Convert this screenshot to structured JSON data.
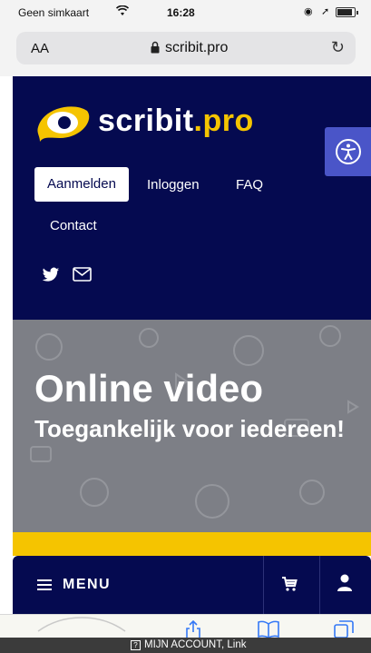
{
  "status_bar": {
    "carrier": "Geen simkaart",
    "time": "16:28",
    "icons": [
      "wifi-icon",
      "orientation-lock-icon",
      "location-icon",
      "battery-icon"
    ]
  },
  "browser": {
    "text_size_label": "AA",
    "url": "scribit.pro",
    "icons": [
      "lock-icon",
      "reload-icon"
    ]
  },
  "site": {
    "logo": {
      "name": "scribit",
      "tld": ".pro"
    },
    "nav": {
      "register": "Aanmelden",
      "login": "Inloggen",
      "faq": "FAQ",
      "contact": "Contact"
    },
    "social_icons": [
      "twitter-icon",
      "mail-icon"
    ],
    "accessibility_icon": "accessibility-icon"
  },
  "hero": {
    "title": "Online video",
    "subtitle": "Toegankelijk voor iedereen!"
  },
  "menu_bar": {
    "menu_label": "MENU",
    "icons": [
      "hamburger-icon",
      "cart-icon",
      "user-icon"
    ]
  },
  "voiceover": {
    "caption": "MIJN ACCOUNT, Link"
  },
  "colors": {
    "brand_navy": "#050a50",
    "brand_yellow": "#f5c400",
    "accessibility_blue": "#4a55c8",
    "hero_gray": "#7d7f86"
  }
}
